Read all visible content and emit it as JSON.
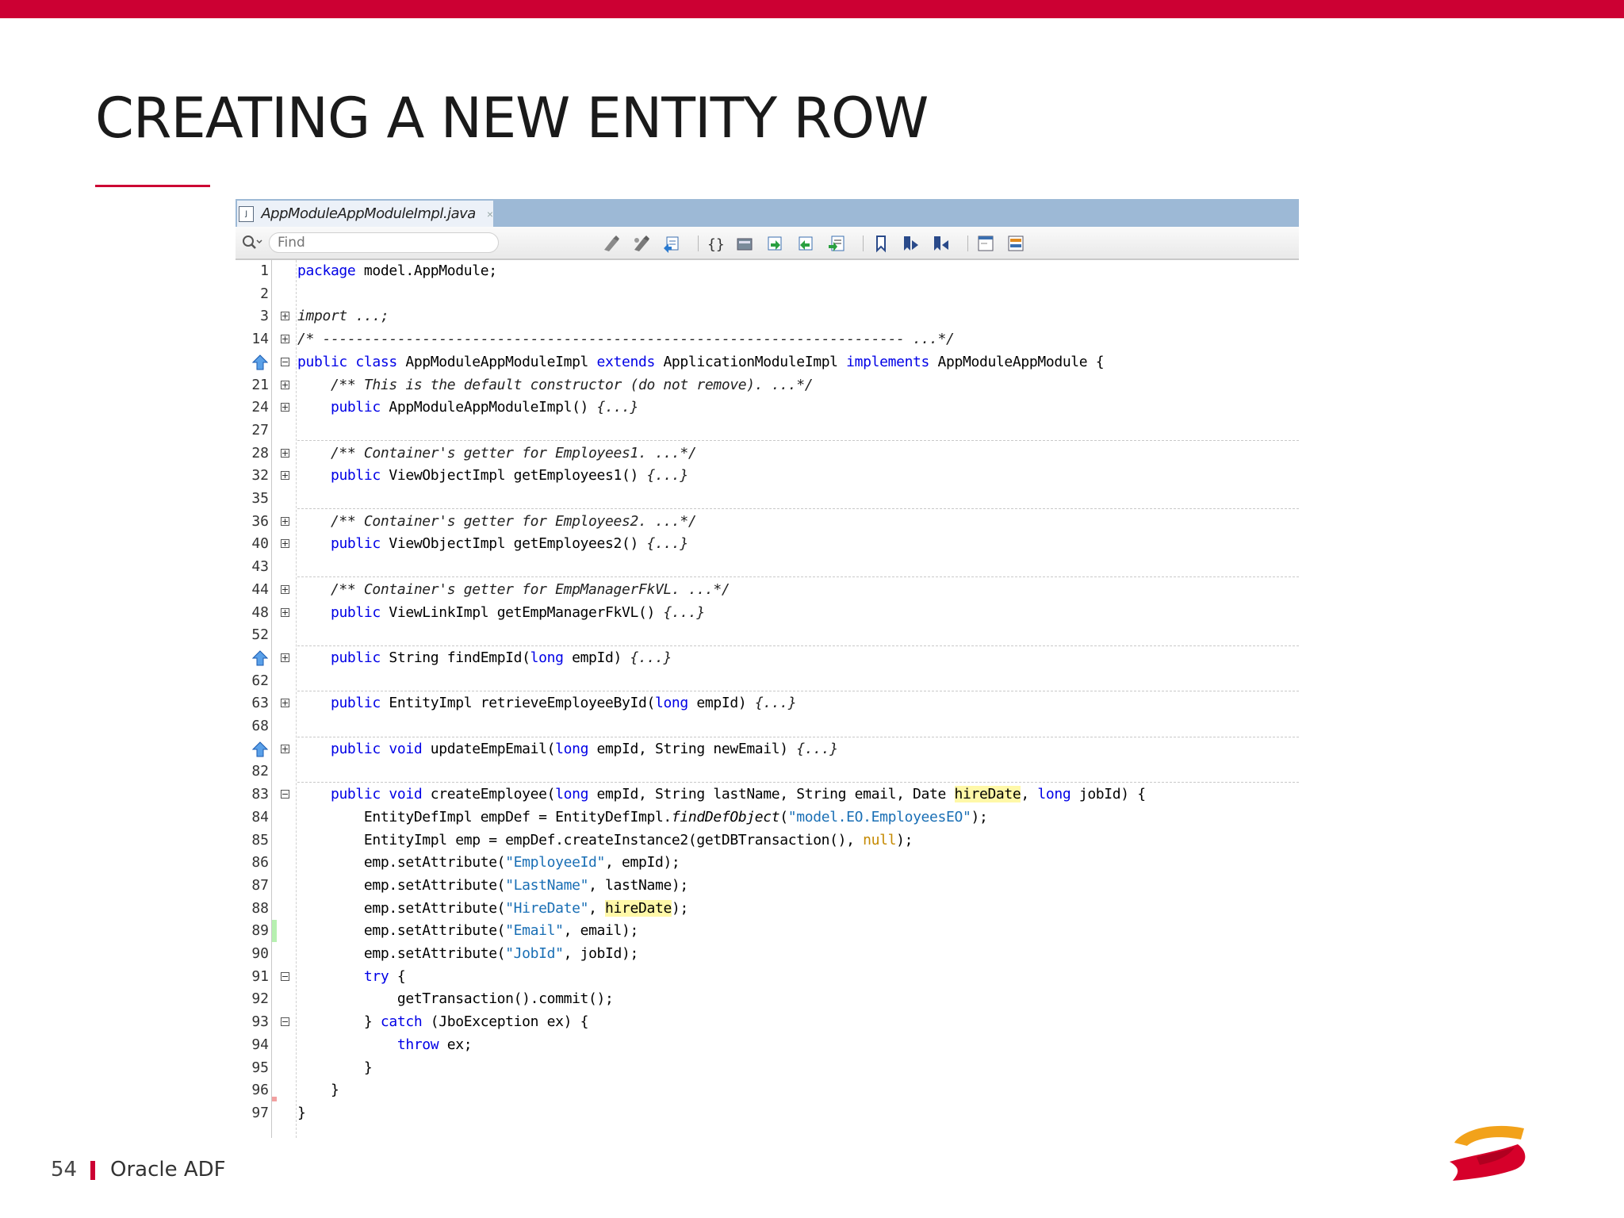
{
  "slide": {
    "title": "CREATING A NEW ENTITY ROW",
    "page_number": "54",
    "footer_text": "Oracle ADF",
    "accent_color": "#cc0033"
  },
  "editor": {
    "tab_label": "AppModuleAppModuleImpl.java",
    "tab_close": "×",
    "find_placeholder": "Find",
    "toolbar_icons": [
      "search-icon",
      "previous-occurrence-icon",
      "next-occurrence-icon",
      "toggle-highlight-icon",
      "toggle-rectangular-selection-icon",
      "shift-left-icon",
      "shift-right-icon",
      "start-macro-icon",
      "stop-macro-icon",
      "toggle-bookmark-icon",
      "previous-bookmark-icon",
      "next-bookmark-icon",
      "comment-icon",
      "uncomment-icon"
    ]
  },
  "code": {
    "line_numbers": [
      "1",
      "2",
      "3",
      "14",
      "",
      "21",
      "24",
      "27",
      "28",
      "32",
      "35",
      "36",
      "40",
      "43",
      "44",
      "48",
      "52",
      "",
      "62",
      "63",
      "68",
      "",
      "82",
      "83",
      "84",
      "85",
      "86",
      "87",
      "88",
      "89",
      "90",
      "91",
      "92",
      "93",
      "94",
      "95",
      "96",
      "97"
    ],
    "lines": [
      "package model.AppModule;",
      "",
      "import ...;",
      "/* ---------------------------------------------------------------------- ...*/",
      "public class AppModuleAppModuleImpl extends ApplicationModuleImpl implements AppModuleAppModule {",
      "    /** This is the default constructor (do not remove). ...*/",
      "    public AppModuleAppModuleImpl() {...}",
      "",
      "    /** Container's getter for Employees1. ...*/",
      "    public ViewObjectImpl getEmployees1() {...}",
      "",
      "    /** Container's getter for Employees2. ...*/",
      "    public ViewObjectImpl getEmployees2() {...}",
      "",
      "    /** Container's getter for EmpManagerFkVL. ...*/",
      "    public ViewLinkImpl getEmpManagerFkVL() {...}",
      "",
      "    public String findEmpId(long empId) {...}",
      "",
      "    public EntityImpl retrieveEmployeeById(long empId) {...}",
      "",
      "    public void updateEmpEmail(long empId, String newEmail) {...}",
      "",
      "    public void createEmployee(long empId, String lastName, String email, Date hireDate, long jobId) {",
      "        EntityDefImpl empDef = EntityDefImpl.findDefObject(\"model.EO.EmployeesEO\");",
      "        EntityImpl emp = empDef.createInstance2(getDBTransaction(), null);",
      "        emp.setAttribute(\"EmployeeId\", empId);",
      "        emp.setAttribute(\"LastName\", lastName);",
      "        emp.setAttribute(\"HireDate\", hireDate);",
      "        emp.setAttribute(\"Email\", email);",
      "        emp.setAttribute(\"JobId\", jobId);",
      "        try {",
      "            getTransaction().commit();",
      "        } catch (JboException ex) {",
      "            throw ex;",
      "        }",
      "    }",
      "}"
    ]
  }
}
